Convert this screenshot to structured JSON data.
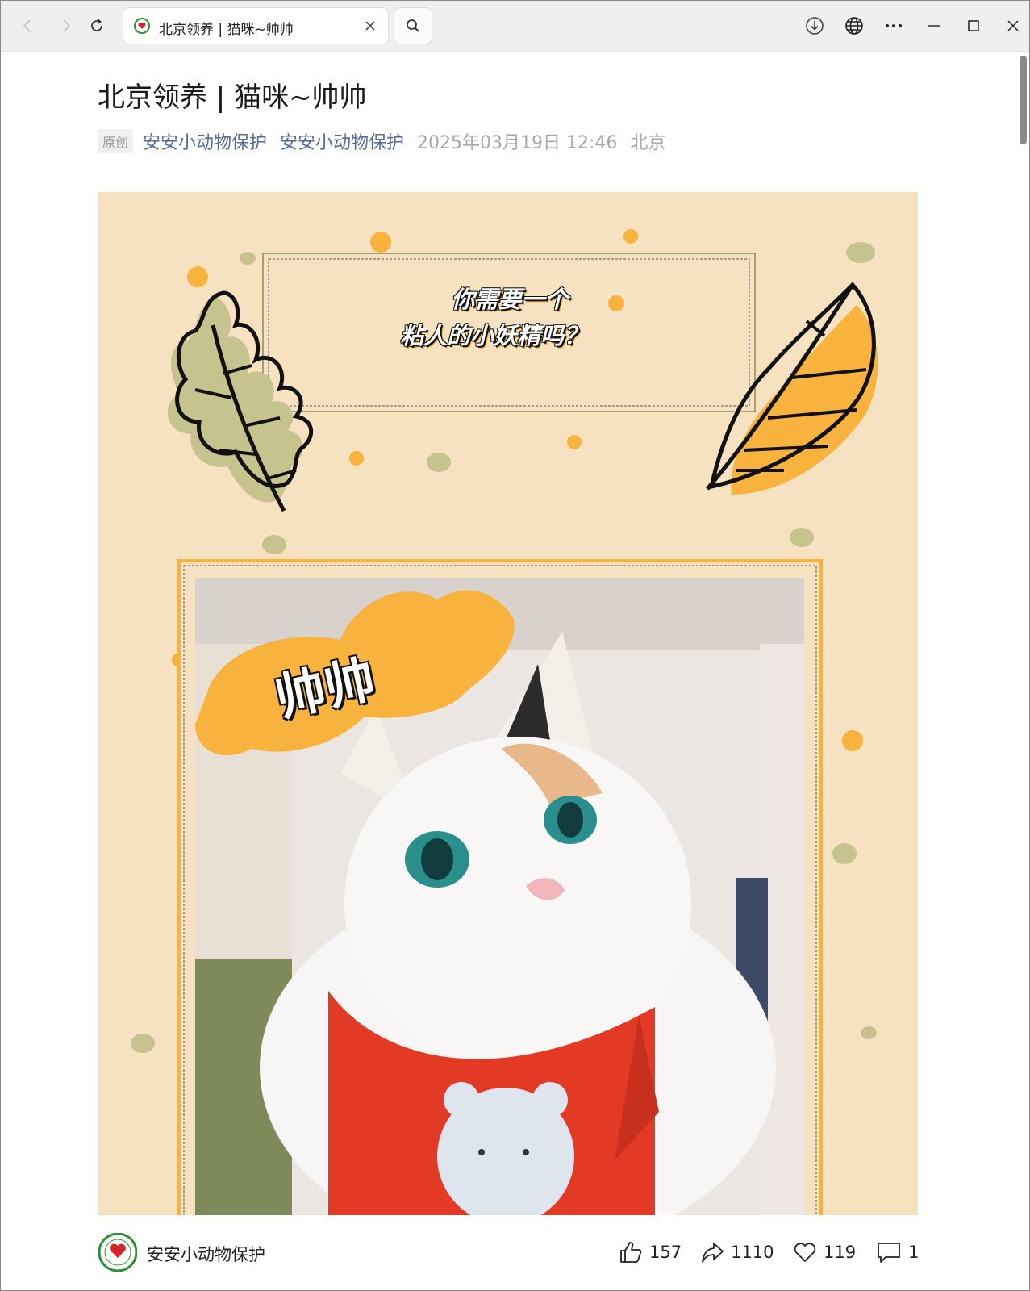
{
  "browser": {
    "tab_title": "北京领养 | 猫咪~帅帅",
    "icons": {
      "back": "chevron-left-icon",
      "forward": "chevron-right-icon",
      "reload": "reload-icon",
      "search": "search-icon",
      "download": "download-icon",
      "translate": "globe-icon",
      "more": "more-icon",
      "minimize": "minimize-icon",
      "maximize": "maximize-icon",
      "close": "close-icon"
    }
  },
  "article": {
    "title": "北京领养 | 猫咪~帅帅",
    "badge": "原创",
    "author_primary": "安安小动物保护",
    "author_secondary": "安安小动物保护",
    "date": "2025年03月19日 12:46",
    "location": "北京",
    "link_color": "#576b95"
  },
  "poster": {
    "headline_line1": "你需要一个",
    "headline_line2": "粘人的小妖精吗？",
    "cat_name": "帅帅",
    "background_color": "#f6e2c1",
    "accent_color": "#f8b33f"
  },
  "footer": {
    "account_name": "安安小动物保护",
    "likes": "157",
    "shares": "1110",
    "favorites": "119",
    "comments": "1"
  }
}
